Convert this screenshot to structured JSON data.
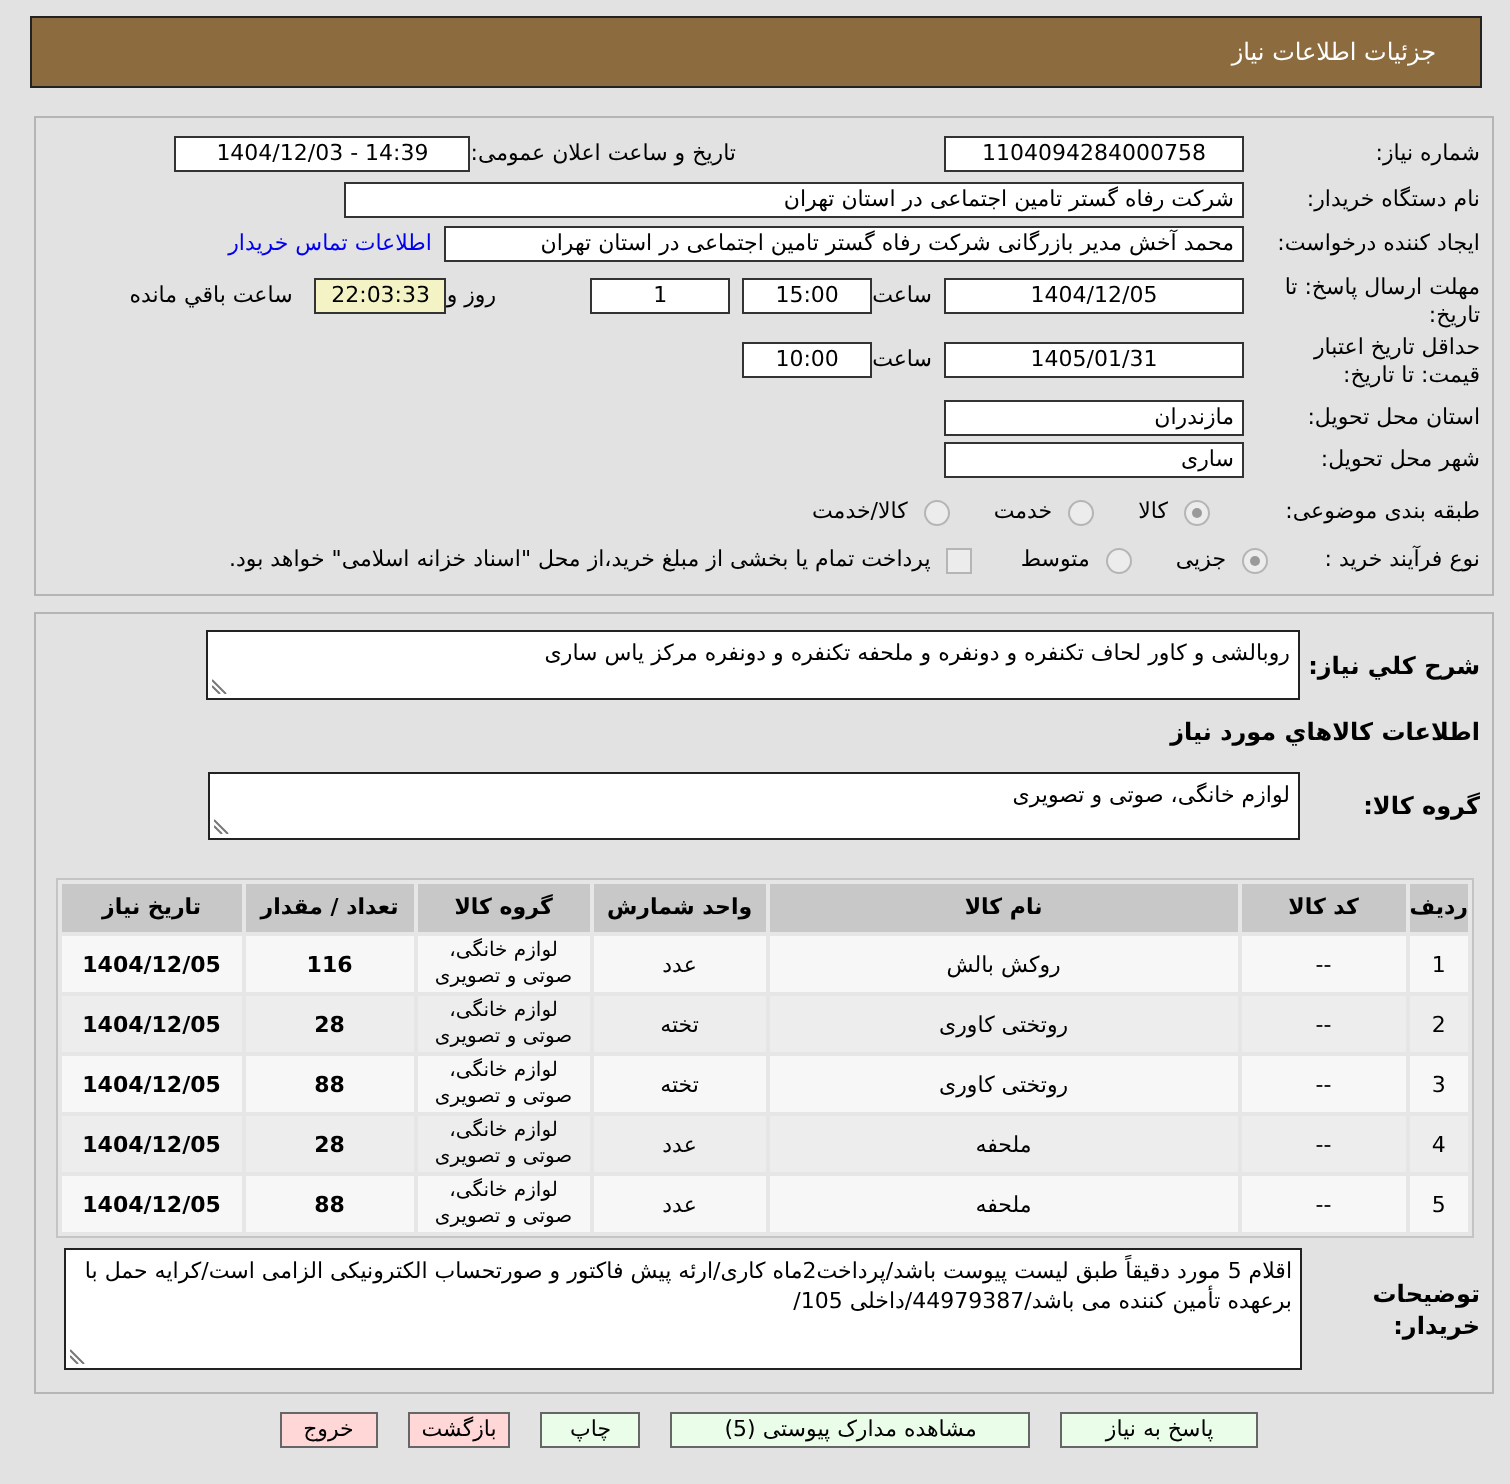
{
  "header": {
    "title": "جزئیات اطلاعات نیاز"
  },
  "need": {
    "need_number": {
      "label": "شماره نیاز:",
      "value": "1104094284000758"
    },
    "announcement": {
      "label": "تاریخ و ساعت اعلان عمومی:",
      "value": "1404/12/03 - 14:39"
    },
    "buyer_org": {
      "label": "نام دستگاه خریدار:",
      "value": "شرکت رفاه گستر تامین اجتماعی در استان تهران"
    },
    "requester": {
      "label": "ایجاد کننده درخواست:",
      "value": "محمد آخش مدیر بازرگانی شرکت رفاه گستر تامین اجتماعی در استان تهران",
      "contact_link": "اطلاعات تماس خریدار"
    },
    "reply_deadline": {
      "label": "مهلت ارسال پاسخ: تا تاریخ:",
      "date": "1404/12/05",
      "time_label": "ساعت",
      "time": "15:00",
      "days": "1",
      "days_label": "روز و",
      "remaining": "22:03:33",
      "remaining_label": "ساعت باقي مانده"
    },
    "price_validity": {
      "label": "حداقل تاریخ اعتبار قیمت: تا تاریخ:",
      "date": "1405/01/31",
      "time_label": "ساعت",
      "time": "10:00"
    },
    "delivery_province": {
      "label": "استان محل تحویل:",
      "value": "مازندران"
    },
    "delivery_city": {
      "label": "شهر محل تحویل:",
      "value": "ساری"
    },
    "category": {
      "label": "طبقه بندی موضوعی:",
      "options": [
        {
          "label": "کالا",
          "selected": true,
          "disabled": true
        },
        {
          "label": "خدمت",
          "selected": false,
          "disabled": true
        },
        {
          "label": "کالا/خدمت",
          "selected": false,
          "disabled": true
        }
      ]
    },
    "purchase_process": {
      "label": "نوع فرآیند خرید :",
      "options": [
        {
          "label": "جزیی",
          "selected": true,
          "disabled": true
        },
        {
          "label": "متوسط",
          "selected": false,
          "disabled": true
        }
      ],
      "treasury_payment": {
        "label": "پرداخت تمام یا بخشی از مبلغ خرید،از محل \"اسناد خزانه اسلامی\" خواهد بود.",
        "checked": false,
        "disabled": true
      }
    }
  },
  "summary": {
    "label": "شرح کلي نياز:",
    "value": "روبالشی و کاور لحاف تکنفره و دونفره و ملحفه تکنفره و دونفره مرکز یاس ساری"
  },
  "goods": {
    "heading": "اطلاعات کالاهاي مورد نياز",
    "group_label": "گروه کالا:",
    "group_value": "لوازم خانگی، صوتی و تصویری"
  },
  "table": {
    "columns": [
      "ردیف",
      "کد کالا",
      "نام کالا",
      "واحد شمارش",
      "گروه کالا",
      "تعداد / مقدار",
      "تاریخ نیاز"
    ],
    "rows": [
      [
        "1",
        "--",
        "روکش بالش",
        "عدد",
        "لوازم خانگی، صوتی و تصویری",
        "116",
        "1404/12/05"
      ],
      [
        "2",
        "--",
        "روتختی کاوری",
        "تخته",
        "لوازم خانگی، صوتی و تصویری",
        "28",
        "1404/12/05"
      ],
      [
        "3",
        "--",
        "روتختی کاوری",
        "تخته",
        "لوازم خانگی، صوتی و تصویری",
        "88",
        "1404/12/05"
      ],
      [
        "4",
        "--",
        "ملحفه",
        "عدد",
        "لوازم خانگی، صوتی و تصویری",
        "28",
        "1404/12/05"
      ],
      [
        "5",
        "--",
        "ملحفه",
        "عدد",
        "لوازم خانگی، صوتی و تصویری",
        "88",
        "1404/12/05"
      ]
    ]
  },
  "buyer_notes": {
    "label": "توضیحات خریدار:",
    "value": "اقلام 5 مورد دقیقاً طبق لیست پیوست باشد/پرداخت2ماه کاری/ارئه پیش فاکتور و صورتحساب الکترونیکی الزامی است/کرایه حمل با برعهده تأمین کننده می باشد/44979387/داخلی 105/"
  },
  "buttons": [
    {
      "label": "پاسخ به نیاز",
      "kind": "action"
    },
    {
      "label": "مشاهده مدارک پیوستی (5)",
      "kind": "action"
    },
    {
      "label": "چاپ",
      "kind": "action"
    },
    {
      "label": "بازگشت",
      "kind": "leave"
    },
    {
      "label": "خروج",
      "kind": "leave"
    }
  ]
}
